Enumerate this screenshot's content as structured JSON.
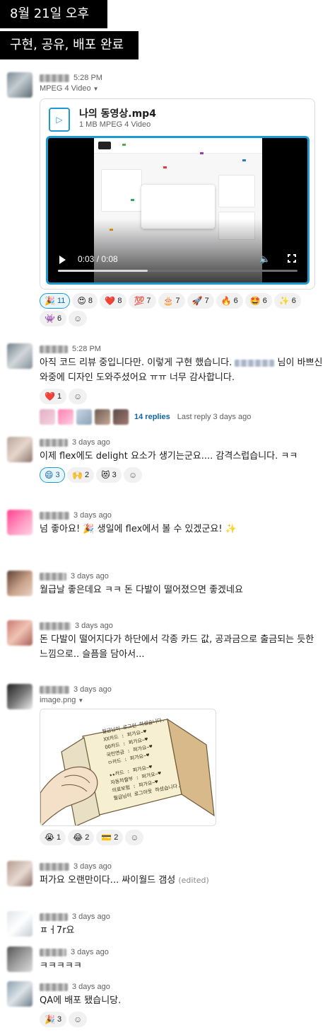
{
  "banners": {
    "date": "8월 21일 오후",
    "caption": "구현, 공유, 배포 완료"
  },
  "messages": [
    {
      "time": "5:28 PM",
      "attachment_label": "MPEG 4 Video",
      "file": {
        "name": "나의 동영상.mp4",
        "meta": "1 MB MPEG 4 Video"
      },
      "video": {
        "time_display": "0:03 / 0:08",
        "progress": 0.375
      },
      "reactions": [
        {
          "emoji": "🎉",
          "count": "11",
          "active": true
        },
        {
          "emoji": "😍",
          "count": "8"
        },
        {
          "emoji": "❤️",
          "count": "8"
        },
        {
          "emoji": "💯",
          "count": "7"
        },
        {
          "emoji": "🎂",
          "count": "7"
        },
        {
          "emoji": "🚀",
          "count": "7"
        },
        {
          "emoji": "🔥",
          "count": "6"
        },
        {
          "emoji": "🤩",
          "count": "6"
        },
        {
          "emoji": "✨",
          "count": "6"
        },
        {
          "emoji": "👾",
          "count": "6"
        }
      ]
    },
    {
      "time": "5:28 PM",
      "text_a": "아직 코드 리뷰 중입니다만. 이렇게 구현 했습니다.",
      "text_b": "님이 바쁘신 와중에 디자인 도와주셨어요 ㅠㅠ 너무 감사합니다.",
      "reactions": [
        {
          "emoji": "❤️",
          "count": "1"
        }
      ],
      "thread": {
        "replies": "14 replies",
        "last": "Last reply 3 days ago"
      }
    },
    {
      "time": "3 days ago",
      "text": "이제 flex에도 delight 요소가 생기는군요.... 감격스럽습니다. ㅋㅋ",
      "reactions": [
        {
          "emoji": "😄",
          "count": "3",
          "active": true
        },
        {
          "emoji": "🙌",
          "count": "2"
        },
        {
          "emoji": "😻",
          "count": "3"
        }
      ]
    },
    {
      "time": "3 days ago",
      "text": "넘 좋아요! 🎉 생일에 flex에서 볼 수 있겠군요! ✨"
    },
    {
      "time": "3 days ago",
      "text": "월급날 좋은데요 ㅋㅋ 돈 다발이 떨어졌으면 좋겠네요"
    },
    {
      "time": "3 days ago",
      "text": "돈 다발이 떨어지다가 하단에서 각종 카드 값, 공과금으로 출금되는 듯한 느낌으로.. 슬픔을 담아서..."
    },
    {
      "time": "3 days ago",
      "attachment_label": "image.png",
      "image_lines": [
        "월급님이 로그인 하셨습니다.",
        "XX카드 : 퍼가요~♥",
        "OO카드 : 퍼가요~♥",
        "국민연금 : 퍼가요~♥",
        "ㅁ카드 : 퍼가요~♥",
        "★★카드 : 퍼가요~♥",
        "자동차할부 : 퍼가요~♥",
        "의료보험 : 퍼가요~♥",
        "월급님이 로그아웃 하셨습니다."
      ],
      "reactions": [
        {
          "emoji": "😭",
          "count": "1"
        },
        {
          "emoji": "😂",
          "count": "2"
        },
        {
          "emoji": "💳",
          "count": "2"
        }
      ]
    },
    {
      "time": "3 days ago",
      "text": "퍼가요 오랜만이다... 싸이월드 갬성",
      "edited": "(edited)"
    },
    {
      "time": "3 days ago",
      "text": "ㅍㅓ7r요"
    },
    {
      "time": "3 days ago",
      "text": "ㅋㅋㅋㅋㅋ"
    },
    {
      "time": "3 days ago",
      "text": "QA에 배포 됐습니당.",
      "reactions": [
        {
          "emoji": "🎉",
          "count": "3"
        }
      ]
    }
  ],
  "colors": {
    "link": "#1264a3",
    "accent": "#1d9bd1",
    "banner": "#000000"
  }
}
